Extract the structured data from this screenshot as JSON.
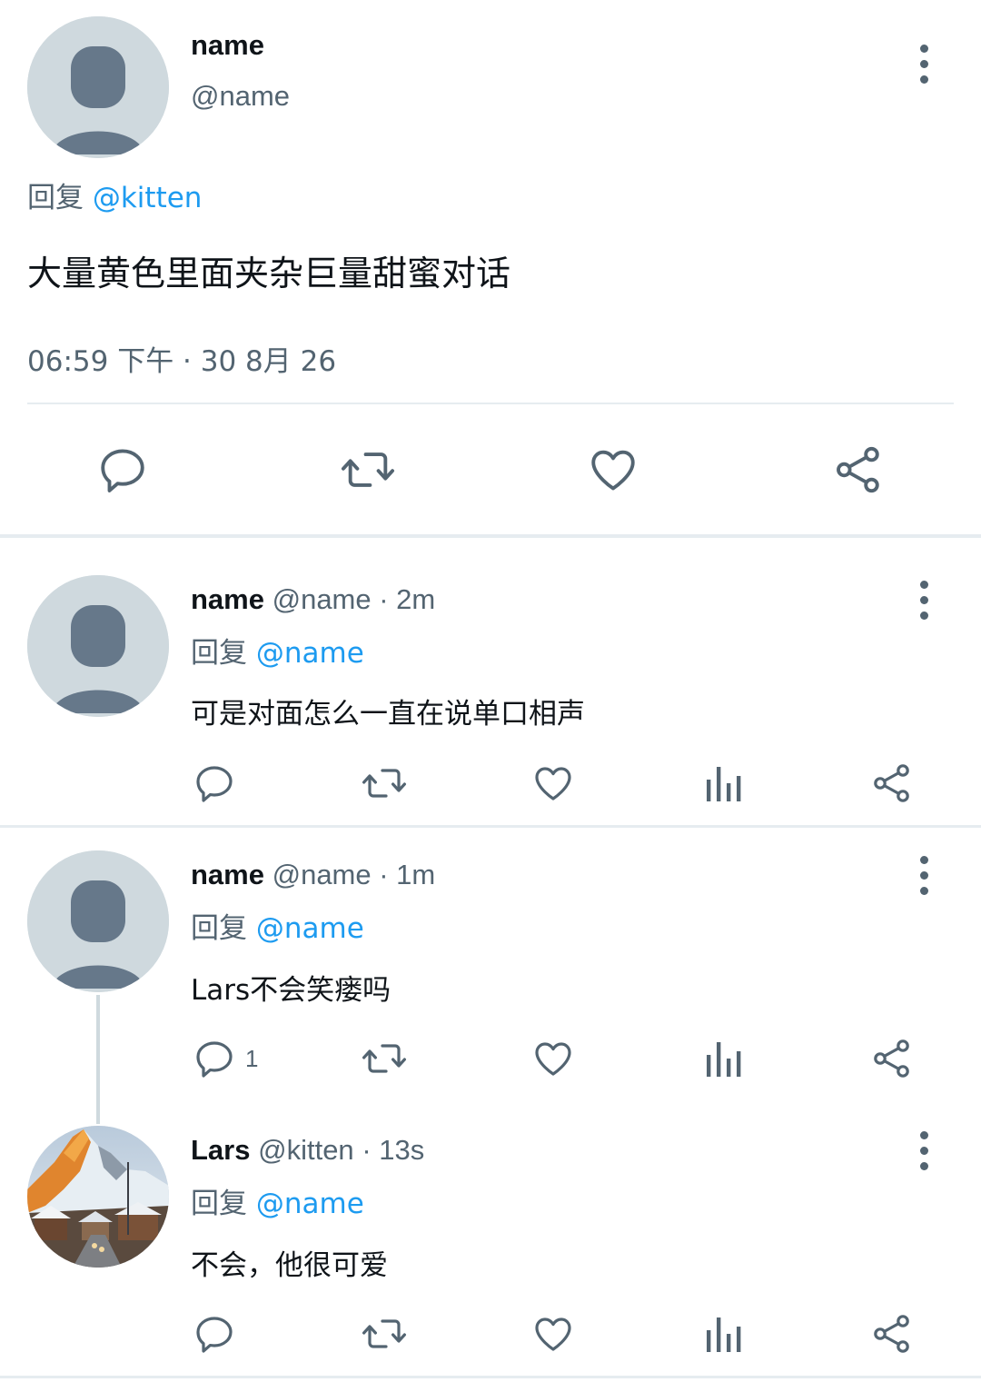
{
  "colors": {
    "accent": "#1d9bf0",
    "secondary_text": "#536471",
    "primary_text": "#0f1419",
    "divider": "#e6ecf0"
  },
  "main_tweet": {
    "name": "name",
    "handle": "@name",
    "reply_prefix": "回复",
    "reply_to": "@kitten",
    "text": "大量黄色里面夹杂巨量甜蜜对话",
    "timestamp": "06:59 下午 · 30 8月 26",
    "actions": [
      "reply-icon",
      "retweet-icon",
      "like-icon",
      "share-icon"
    ]
  },
  "replies": [
    {
      "name": "name",
      "handle": "@name",
      "time": "· 2m",
      "reply_prefix": "回复",
      "reply_to": "@name",
      "text": "可是对面怎么一直在说单口相声",
      "reply_count": ""
    },
    {
      "name": "name",
      "handle": "@name",
      "time": "· 1m",
      "reply_prefix": "回复",
      "reply_to": "@name",
      "text": "Lars不会笑瘘吗",
      "reply_count": "1"
    },
    {
      "name": "Lars",
      "handle": "@kitten",
      "time": "· 13s",
      "reply_prefix": "回复",
      "reply_to": "@name",
      "text": "不会，他很可爱",
      "reply_count": ""
    }
  ]
}
